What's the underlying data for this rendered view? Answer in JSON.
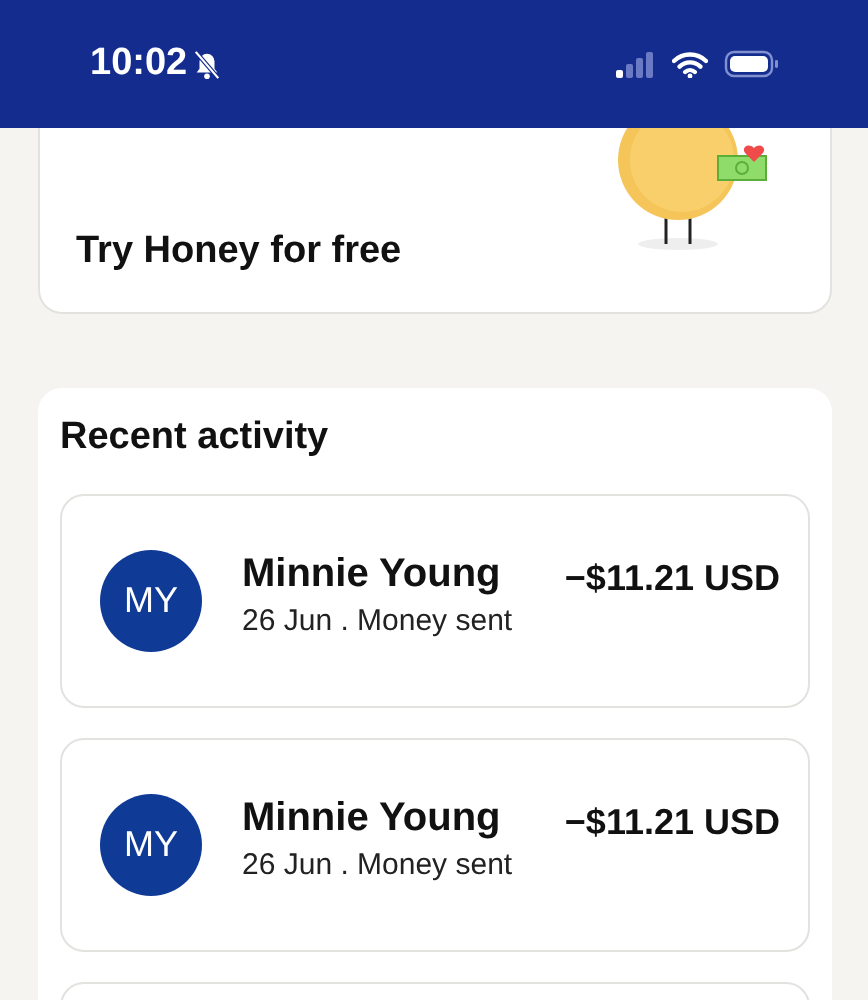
{
  "status_bar": {
    "time": "10:02",
    "notifications_muted": true
  },
  "promo": {
    "title": "Try Honey for free"
  },
  "recent_activity": {
    "title": "Recent activity",
    "items": [
      {
        "initials": "MY",
        "name": "Minnie Young",
        "detail": "26 Jun . Money sent",
        "amount": "−$11.21 USD"
      },
      {
        "initials": "MY",
        "name": "Minnie Young",
        "detail": "26 Jun . Money sent",
        "amount": "−$11.21 USD"
      }
    ]
  }
}
